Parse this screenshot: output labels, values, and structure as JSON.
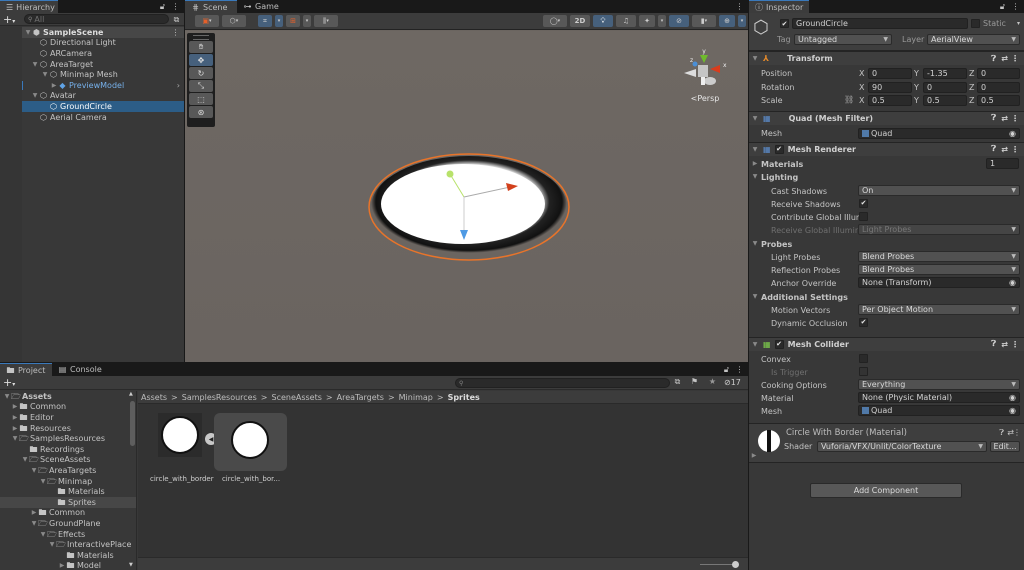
{
  "hierarchy": {
    "tab_label": "Hierarchy",
    "search_placeholder": "All",
    "items": [
      {
        "label": "SampleScene",
        "depth": 0,
        "expanded": true,
        "type": "scene"
      },
      {
        "label": "Directional Light",
        "depth": 1,
        "type": "gameobject"
      },
      {
        "label": "ARCamera",
        "depth": 1,
        "type": "gameobject"
      },
      {
        "label": "AreaTarget",
        "depth": 1,
        "expanded": true,
        "type": "gameobject"
      },
      {
        "label": "Minimap Mesh",
        "depth": 2,
        "expanded": true,
        "type": "gameobject"
      },
      {
        "label": "PreviewModel",
        "depth": 3,
        "collapsed": true,
        "type": "prefab"
      },
      {
        "label": "Avatar",
        "depth": 1,
        "expanded": true,
        "type": "gameobject"
      },
      {
        "label": "GroundCircle",
        "depth": 2,
        "selected": true,
        "type": "gameobject"
      },
      {
        "label": "Aerial Camera",
        "depth": 1,
        "type": "gameobject"
      }
    ]
  },
  "scene": {
    "tabs": [
      {
        "label": "Scene",
        "active": true
      },
      {
        "label": "Game",
        "active": false
      }
    ],
    "toolbar": {
      "btn_2d": "2D"
    },
    "gizmo": {
      "persp_label": "Persp",
      "axis_y": "y",
      "axis_x": "x",
      "axis_z": "z"
    },
    "tools": [
      "hand",
      "move",
      "rotate",
      "scale",
      "rect",
      "transform"
    ],
    "active_tool": "move"
  },
  "inspector": {
    "tab_label": "Inspector",
    "object_name": "GroundCircle",
    "active": true,
    "static_label": "Static",
    "tag_label": "Tag",
    "tag_value": "Untagged",
    "layer_label": "Layer",
    "layer_value": "AerialView",
    "transform": {
      "title": "Transform",
      "rows": [
        {
          "label": "Position",
          "x": "0",
          "y": "-1.35",
          "z": "0"
        },
        {
          "label": "Rotation",
          "x": "90",
          "y": "0",
          "z": "0"
        },
        {
          "label": "Scale",
          "x": "0.5",
          "y": "0.5",
          "z": "0.5"
        }
      ]
    },
    "mesh_filter": {
      "title": "Quad (Mesh Filter)",
      "mesh_label": "Mesh",
      "mesh_value": "Quad"
    },
    "mesh_renderer": {
      "title": "Mesh Renderer",
      "materials_label": "Materials",
      "materials_count": "1",
      "lighting_label": "Lighting",
      "cast_shadows_label": "Cast Shadows",
      "cast_shadows_value": "On",
      "receive_shadows_label": "Receive Shadows",
      "contribute_gi_label": "Contribute Global Illumi",
      "receive_gi_label": "Receive Global Illumina",
      "receive_gi_value": "Light Probes",
      "probes_label": "Probes",
      "light_probes_label": "Light Probes",
      "light_probes_value": "Blend Probes",
      "reflection_probes_label": "Reflection Probes",
      "reflection_probes_value": "Blend Probes",
      "anchor_override_label": "Anchor Override",
      "anchor_override_value": "None (Transform)",
      "additional_label": "Additional Settings",
      "motion_vectors_label": "Motion Vectors",
      "motion_vectors_value": "Per Object Motion",
      "dynamic_occlusion_label": "Dynamic Occlusion"
    },
    "mesh_collider": {
      "title": "Mesh Collider",
      "convex_label": "Convex",
      "is_trigger_label": "Is Trigger",
      "cooking_label": "Cooking Options",
      "cooking_value": "Everything",
      "material_label": "Material",
      "material_value": "None (Physic Material)",
      "mesh_label": "Mesh",
      "mesh_value": "Quad"
    },
    "material": {
      "title": "Circle With Border (Material)",
      "shader_label": "Shader",
      "shader_value": "Vuforia/VFX/Unlit/ColorTexture",
      "edit_label": "Edit..."
    },
    "add_component_label": "Add Component"
  },
  "project": {
    "tabs": [
      {
        "label": "Project",
        "active": true
      },
      {
        "label": "Console",
        "active": false
      }
    ],
    "hidden_count": "17",
    "tree": [
      {
        "label": "Assets",
        "depth": 0,
        "expanded": true,
        "bold": true
      },
      {
        "label": "Common",
        "depth": 1,
        "collapsed": true
      },
      {
        "label": "Editor",
        "depth": 1,
        "collapsed": true
      },
      {
        "label": "Resources",
        "depth": 1,
        "collapsed": true
      },
      {
        "label": "SamplesResources",
        "depth": 1,
        "expanded": true
      },
      {
        "label": "Recordings",
        "depth": 2
      },
      {
        "label": "SceneAssets",
        "depth": 2,
        "expanded": true
      },
      {
        "label": "AreaTargets",
        "depth": 3,
        "expanded": true
      },
      {
        "label": "Minimap",
        "depth": 4,
        "expanded": true
      },
      {
        "label": "Materials",
        "depth": 5
      },
      {
        "label": "Sprites",
        "depth": 5,
        "selected": true
      },
      {
        "label": "Common",
        "depth": 3,
        "collapsed": true
      },
      {
        "label": "GroundPlane",
        "depth": 3,
        "expanded": true
      },
      {
        "label": "Effects",
        "depth": 4,
        "expanded": true
      },
      {
        "label": "InteractivePlace",
        "depth": 5,
        "expanded": true
      },
      {
        "label": "Materials",
        "depth": 6
      },
      {
        "label": "Model",
        "depth": 6,
        "collapsed": true
      }
    ],
    "breadcrumb": [
      "Assets",
      "SamplesResources",
      "SceneAssets",
      "AreaTargets",
      "Minimap",
      "Sprites"
    ],
    "assets": [
      {
        "label": "circle_with_border"
      },
      {
        "label": "circle_with_bor..."
      }
    ]
  }
}
